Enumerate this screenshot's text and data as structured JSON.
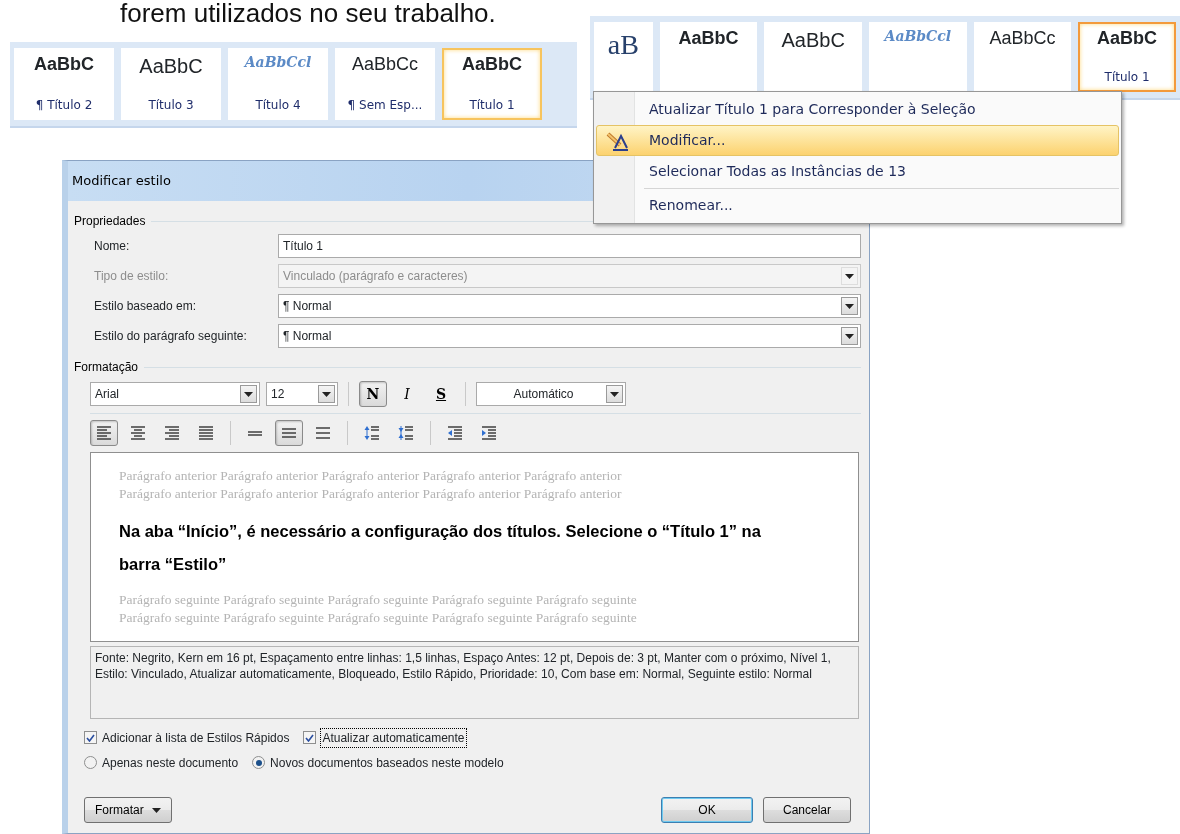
{
  "document_text": "forem utilizados no seu trabalho.",
  "left_gallery": {
    "items": [
      {
        "sample": "AaBbC",
        "kind": "heavy",
        "label": "¶ Título 2",
        "selected": false
      },
      {
        "sample": "AaBbC",
        "kind": "large",
        "label": "Título 3",
        "selected": false
      },
      {
        "sample": "AaBbCcl",
        "kind": "italic-serif",
        "label": "Título 4",
        "selected": false
      },
      {
        "sample": "AaBbCc",
        "kind": "plain",
        "label": "¶ Sem Esp...",
        "selected": false
      },
      {
        "sample": "AaBbC",
        "kind": "heavy",
        "label": "Título 1",
        "selected": true
      }
    ]
  },
  "right_gallery": {
    "items": [
      {
        "sample": "aB",
        "kind": "serif-large",
        "selected": false
      },
      {
        "sample": "AaBbC",
        "kind": "heavy",
        "selected": false
      },
      {
        "sample": "AaBbC",
        "kind": "large",
        "selected": false
      },
      {
        "sample": "AaBbCcl",
        "kind": "italic-serif",
        "selected": false
      },
      {
        "sample": "AaBbCc",
        "kind": "plain",
        "selected": false
      },
      {
        "sample": "AaBbC",
        "kind": "heavy",
        "label": "Título 1",
        "selected": true
      }
    ]
  },
  "context_menu": {
    "items": [
      {
        "kind": "plain",
        "text": "Atualizar Título 1 para Corresponder à Seleção",
        "selected": false
      },
      {
        "kind": "with-icon",
        "text": "Modificar...",
        "selected": true
      },
      {
        "kind": "plain",
        "text": "Selecionar Todas as Instâncias de 13",
        "selected": false
      },
      {
        "kind": "separator"
      },
      {
        "kind": "plain",
        "text": "Renomear...",
        "selected": false
      }
    ]
  },
  "dialog": {
    "title": "Modificar estilo",
    "properties": {
      "heading": "Propriedades",
      "rows": [
        {
          "label": "Nome:",
          "value": "Título 1",
          "kind": "text",
          "disabled": false
        },
        {
          "label": "Tipo de estilo:",
          "value": "Vinculado (parágrafo e caracteres)",
          "kind": "select",
          "disabled": true
        },
        {
          "label": "Estilo baseado em:",
          "value": "¶ Normal",
          "kind": "select",
          "disabled": false
        },
        {
          "label": "Estilo do parágrafo seguinte:",
          "value": "¶ Normal",
          "kind": "select",
          "disabled": false
        }
      ]
    },
    "formatting": {
      "heading": "Formatação",
      "font": "Arial",
      "size": "12",
      "text_buttons": [
        {
          "text": "N",
          "kind": "bold",
          "pressed": true
        },
        {
          "text": "I",
          "kind": "italic",
          "pressed": false
        },
        {
          "text": "S",
          "kind": "underline",
          "pressed": false
        }
      ],
      "font_color": "Automático",
      "paragraph_groups": [
        [
          {
            "kind": "align-left",
            "pressed": true
          },
          {
            "kind": "align-center",
            "pressed": false
          },
          {
            "kind": "align-right",
            "pressed": false
          },
          {
            "kind": "justify",
            "pressed": false
          }
        ],
        [
          {
            "kind": "single-spacing",
            "pressed": false
          },
          {
            "kind": "one-half-spacing",
            "pressed": true
          },
          {
            "kind": "double-spacing",
            "pressed": false
          }
        ],
        [
          {
            "kind": "space-increase",
            "pressed": false
          },
          {
            "kind": "space-decrease",
            "pressed": false
          }
        ],
        [
          {
            "kind": "indent-decrease",
            "pressed": false
          },
          {
            "kind": "indent-increase",
            "pressed": false
          }
        ]
      ]
    },
    "preview": {
      "previous_lines": [
        "Parágrafo anterior Parágrafo anterior Parágrafo anterior Parágrafo anterior Parágrafo anterior",
        "Parágrafo anterior Parágrafo anterior Parágrafo anterior Parágrafo anterior Parágrafo anterior"
      ],
      "sample": "Na aba “Início”, é necessário a configuração dos títulos. Selecione o “Título 1” na barra “Estilo”",
      "next_lines": [
        "Parágrafo seguinte Parágrafo seguinte Parágrafo seguinte Parágrafo seguinte Parágrafo seguinte",
        "Parágrafo seguinte Parágrafo seguinte Parágrafo seguinte Parágrafo seguinte Parágrafo seguinte"
      ]
    },
    "description": "Fonte: Negrito, Kern em 16 pt, Espaçamento entre linhas:  1,5 linhas, Espaço Antes:  12 pt, Depois de:  3 pt, Manter com o próximo, Nível 1, Estilo: Vinculado, Atualizar automaticamente, Bloqueado, Estilo Rápido, Prioridade: 10, Com base em: Normal, Seguinte estilo: Normal",
    "checkboxes": [
      {
        "label": "Adicionar à lista de Estilos Rápidos",
        "checked": true,
        "focused": false
      },
      {
        "label": "Atualizar automaticamente",
        "checked": true,
        "focused": true
      }
    ],
    "radios": [
      {
        "label": "Apenas neste documento",
        "selected": false
      },
      {
        "label": "Novos documentos baseados neste modelo",
        "selected": true
      }
    ],
    "buttons": [
      {
        "label": "Formatar",
        "kind": "menu"
      },
      {
        "label": "OK",
        "kind": "default"
      },
      {
        "label": "Cancelar",
        "kind": "normal"
      }
    ]
  }
}
